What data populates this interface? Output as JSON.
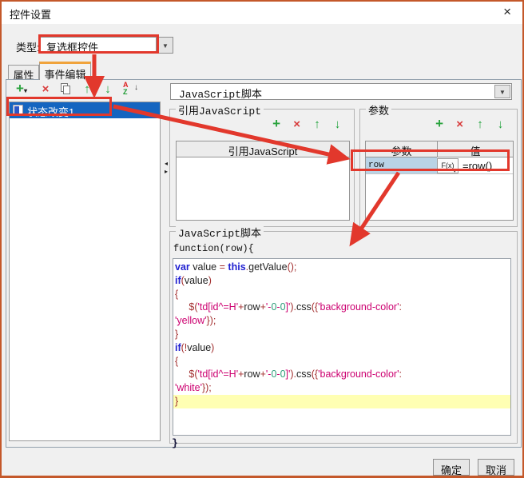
{
  "window": {
    "title": "控件设置"
  },
  "icons": {
    "close": "×",
    "combo_caret": "▼",
    "caret_small": "▾",
    "add": "+",
    "delete": "×",
    "up": "↑",
    "down": "↓",
    "sort_a": "A",
    "sort_z": "Z",
    "sort_arrow": "↓",
    "split_left": "◂",
    "split_right": "▸",
    "fx_caret": "▾"
  },
  "type_row": {
    "label": "类型:",
    "value": "复选框控件"
  },
  "tabs": {
    "properties": "属性",
    "event_edit": "事件编辑"
  },
  "event_list": [
    {
      "label": "状态改变1",
      "selected": true
    }
  ],
  "event_type_dropdown": {
    "value": "JavaScript脚本"
  },
  "ref_js_group": {
    "title": "引用JavaScript",
    "table_header": "引用JavaScript"
  },
  "params_group": {
    "title": "参数",
    "columns": {
      "name": "参数",
      "value": "值"
    },
    "rows": [
      {
        "name": "row",
        "fx_label": "F(x)",
        "value": "=row()"
      }
    ]
  },
  "script_group": {
    "title": "JavaScript脚本",
    "prefix": "function(row){",
    "suffix": "}",
    "code_lines": [
      {
        "highlight": false,
        "tokens": [
          [
            "k",
            "var"
          ],
          [
            "p",
            " value "
          ],
          [
            "o",
            "="
          ],
          [
            "p",
            " "
          ],
          [
            "k",
            "this"
          ],
          [
            "o",
            "."
          ],
          [
            "p",
            "getValue"
          ],
          [
            "o",
            "();"
          ]
        ]
      },
      {
        "highlight": false,
        "tokens": [
          [
            "k",
            "if"
          ],
          [
            "o",
            "("
          ],
          [
            "p",
            "value"
          ],
          [
            "o",
            ")"
          ]
        ]
      },
      {
        "highlight": false,
        "tokens": [
          [
            "o",
            "{"
          ]
        ]
      },
      {
        "highlight": false,
        "tokens": [
          [
            "p",
            "     "
          ],
          [
            "o",
            "$("
          ],
          [
            "s",
            "'td[id^=H'"
          ],
          [
            "o",
            "+"
          ],
          [
            "p",
            "row"
          ],
          [
            "o",
            "+"
          ],
          [
            "s",
            "'-"
          ],
          [
            "n",
            "0"
          ],
          [
            "s",
            "-"
          ],
          [
            "n",
            "0"
          ],
          [
            "s",
            "]'"
          ],
          [
            "o",
            ")."
          ],
          [
            "p",
            "css"
          ],
          [
            "o",
            "({"
          ],
          [
            "s",
            "'background-color'"
          ],
          [
            "o",
            ":"
          ]
        ]
      },
      {
        "highlight": false,
        "tokens": [
          [
            "s",
            "'yellow'"
          ],
          [
            "o",
            "});"
          ]
        ]
      },
      {
        "highlight": false,
        "tokens": [
          [
            "o",
            "}"
          ]
        ]
      },
      {
        "highlight": false,
        "tokens": [
          [
            "k",
            "if"
          ],
          [
            "o",
            "(!"
          ],
          [
            "p",
            "value"
          ],
          [
            "o",
            ")"
          ]
        ]
      },
      {
        "highlight": false,
        "tokens": [
          [
            "o",
            "{"
          ]
        ]
      },
      {
        "highlight": false,
        "tokens": [
          [
            "p",
            "     "
          ],
          [
            "o",
            "$("
          ],
          [
            "s",
            "'td[id^=H'"
          ],
          [
            "o",
            "+"
          ],
          [
            "p",
            "row"
          ],
          [
            "o",
            "+"
          ],
          [
            "s",
            "'-"
          ],
          [
            "n",
            "0"
          ],
          [
            "s",
            "-"
          ],
          [
            "n",
            "0"
          ],
          [
            "s",
            "]'"
          ],
          [
            "o",
            ")."
          ],
          [
            "p",
            "css"
          ],
          [
            "o",
            "({"
          ],
          [
            "s",
            "'background-color'"
          ],
          [
            "o",
            ":"
          ]
        ]
      },
      {
        "highlight": false,
        "tokens": [
          [
            "s",
            "'white'"
          ],
          [
            "o",
            "});"
          ]
        ]
      },
      {
        "highlight": true,
        "tokens": [
          [
            "o",
            "}"
          ]
        ]
      }
    ]
  },
  "footer": {
    "ok": "确定",
    "cancel": "取消"
  },
  "colors": {
    "window_border_orange": "#c4582a",
    "tab_accent_orange": "#f0a33c",
    "annotation_red": "#e2382c",
    "selection_blue": "#1565c0",
    "param_cell_blue": "#b9d3e6",
    "highlight_yellow": "#ffffb3",
    "keyword_blue": "#1f1fd0",
    "string_magenta": "#cc0070",
    "operator_red": "#a33030",
    "number_teal": "#2e9d7a",
    "icon_green": "#2aa33e",
    "icon_red": "#d83c3c"
  }
}
